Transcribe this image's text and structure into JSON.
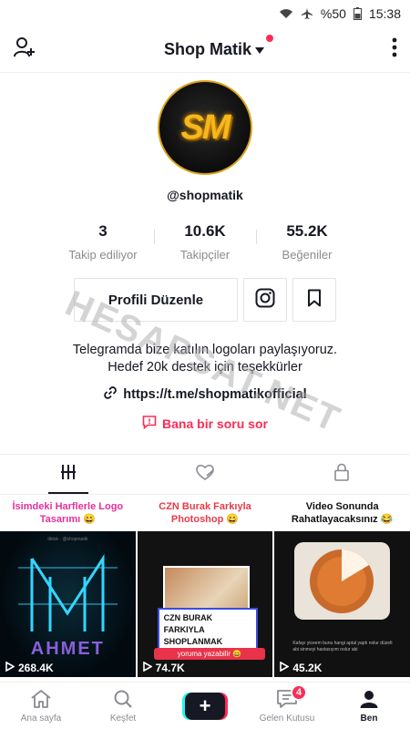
{
  "status": {
    "battery": "%50",
    "time": "15:38"
  },
  "header": {
    "title": "Shop Matik"
  },
  "profile": {
    "avatar_text": "SM",
    "username": "@shopmatik",
    "stats": [
      {
        "num": "3",
        "label": "Takip ediliyor"
      },
      {
        "num": "10.6K",
        "label": "Takipçiler"
      },
      {
        "num": "55.2K",
        "label": "Beğeniler"
      }
    ],
    "edit_label": "Profili Düzenle",
    "bio_line1": "Telegramda bize katılın logoları paylaşıyoruz.",
    "bio_line2": "Hedef 20k destek için teşekkürler",
    "link": "https://t.me/shopmatikofficial",
    "ask": "Bana bir soru sor"
  },
  "watermark": "HESAPSAT.NET",
  "videos": [
    {
      "caption": "İsimdeki Harflerle Logo Tasarımı 😄",
      "views": "268.4K",
      "thumb_text": "AHMET",
      "thumb_small": "tiktok · @shopmatik"
    },
    {
      "caption": "CZN Burak Farkıyla Photoshop 😄",
      "views": "74.7K",
      "thumb_text1": "CZN BURAK",
      "thumb_text2": "FARKIYLA",
      "thumb_text3": "SHOPLANMAK",
      "thumb_sub": "yoruma yazabilir 😄"
    },
    {
      "caption": "Video Sonunda Rahatlayacaksınız 😂",
      "views": "45.2K",
      "thumb_small": "Kafayı yiceem bunu hangi aptal yaptı nolur düzelt abi sinmeyi hastasıyım nolur abi"
    }
  ],
  "bottom_nav": [
    {
      "label": "Ana sayfa",
      "icon": "home-icon"
    },
    {
      "label": "Keşfet",
      "icon": "search-icon"
    },
    {
      "label": "",
      "icon": "plus-icon"
    },
    {
      "label": "Gelen Kutusu",
      "icon": "inbox-icon",
      "badge": "4"
    },
    {
      "label": "Ben",
      "icon": "person-icon"
    }
  ]
}
